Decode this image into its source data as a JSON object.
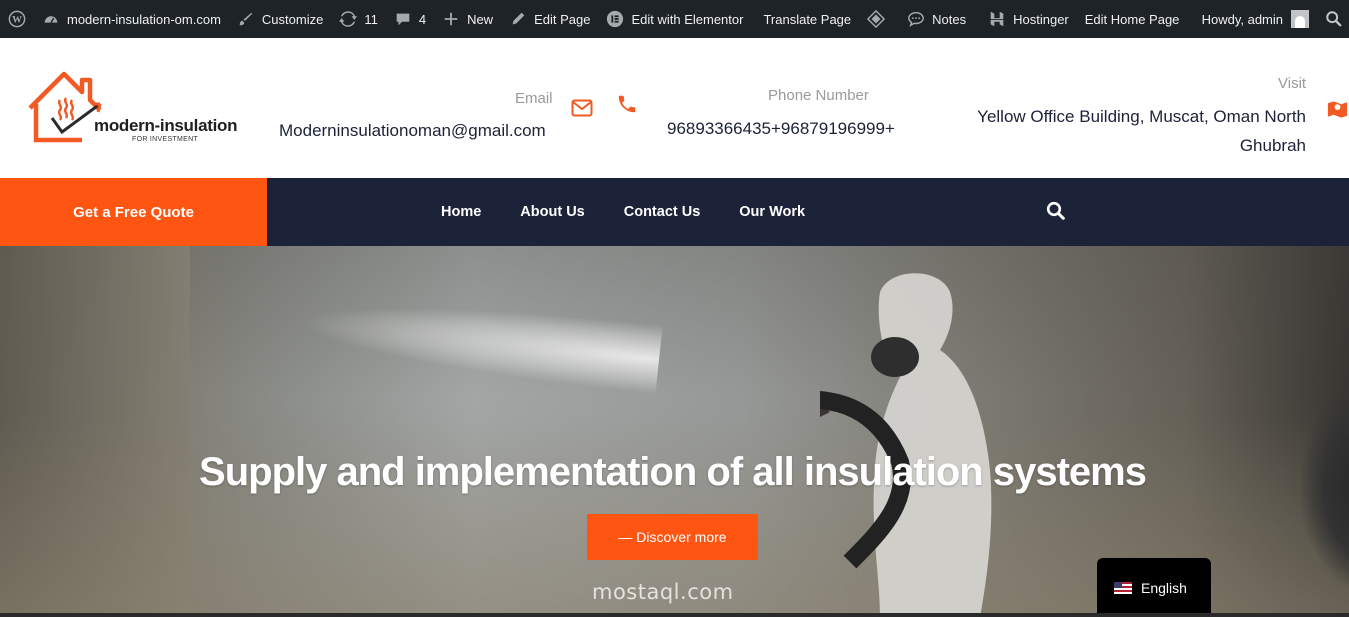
{
  "adminbar": {
    "site_name": "modern-insulation-om.com",
    "customize": "Customize",
    "updates_count": "11",
    "comments_count": "4",
    "new": "New",
    "edit_page": "Edit Page",
    "edit_elementor": "Edit with Elementor",
    "translate_page": "Translate Page",
    "notes": "Notes",
    "hostinger": "Hostinger",
    "edit_home": "Edit Home Page",
    "howdy": "Howdy, admin"
  },
  "logo": {
    "name": "modern-insulation",
    "tagline": "FOR INVESTMENT"
  },
  "contact": {
    "email_label": "Email",
    "email_value": "Moderninsulationoman@gmail.com",
    "phone_label": "Phone Number",
    "phone_value": "96893366435+96879196999+",
    "visit_label": "Visit",
    "visit_line1": "Yellow Office Building, Muscat, Oman North",
    "visit_line2": "Ghubrah"
  },
  "nav": {
    "quote": "Get a Free Quote",
    "items": [
      "Home",
      "About Us",
      "Contact Us",
      "Our Work"
    ]
  },
  "hero": {
    "title": "Supply and implementation of all insulation systems",
    "button": "— Discover more",
    "watermark": "mostaql.com"
  },
  "language": {
    "label": "English"
  },
  "colors": {
    "accent": "#fe5513",
    "navy": "#1c2238",
    "adminbar": "#1d2327"
  }
}
